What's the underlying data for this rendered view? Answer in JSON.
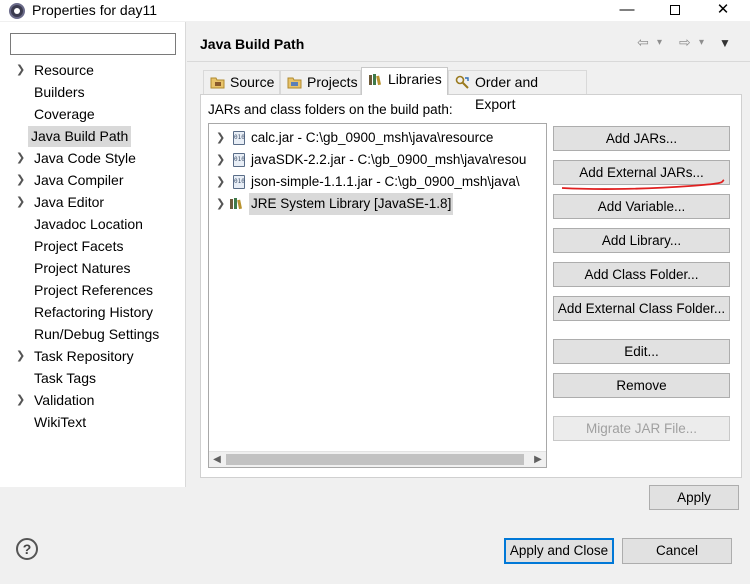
{
  "window": {
    "title": "Properties for day11",
    "icon": "eclipse-icon"
  },
  "filter": {
    "value": "",
    "placeholder": ""
  },
  "tree": [
    {
      "label": "Resource",
      "expandable": true,
      "selected": false
    },
    {
      "label": "Builders",
      "expandable": false,
      "selected": false
    },
    {
      "label": "Coverage",
      "expandable": false,
      "selected": false
    },
    {
      "label": "Java Build Path",
      "expandable": false,
      "selected": true
    },
    {
      "label": "Java Code Style",
      "expandable": true,
      "selected": false
    },
    {
      "label": "Java Compiler",
      "expandable": true,
      "selected": false
    },
    {
      "label": "Java Editor",
      "expandable": true,
      "selected": false
    },
    {
      "label": "Javadoc Location",
      "expandable": false,
      "selected": false
    },
    {
      "label": "Project Facets",
      "expandable": false,
      "selected": false
    },
    {
      "label": "Project Natures",
      "expandable": false,
      "selected": false
    },
    {
      "label": "Project References",
      "expandable": false,
      "selected": false
    },
    {
      "label": "Refactoring History",
      "expandable": false,
      "selected": false
    },
    {
      "label": "Run/Debug Settings",
      "expandable": false,
      "selected": false
    },
    {
      "label": "Task Repository",
      "expandable": true,
      "selected": false
    },
    {
      "label": "Task Tags",
      "expandable": false,
      "selected": false
    },
    {
      "label": "Validation",
      "expandable": true,
      "selected": false
    },
    {
      "label": "WikiText",
      "expandable": false,
      "selected": false
    }
  ],
  "page": {
    "title": "Java Build Path"
  },
  "tabs": [
    {
      "label": "Source",
      "active": false
    },
    {
      "label": "Projects",
      "active": false
    },
    {
      "label": "Libraries",
      "active": true
    },
    {
      "label": "Order and Export",
      "active": false
    }
  ],
  "libraries": {
    "header": "JARs and class folders on the build path:",
    "items": [
      {
        "label": "calc.jar - C:\\gb_0900_msh\\java\\resource",
        "type": "jar"
      },
      {
        "label": "javaSDK-2.2.jar - C:\\gb_0900_msh\\java\\resou",
        "type": "jar"
      },
      {
        "label": "json-simple-1.1.1.jar - C:\\gb_0900_msh\\java\\",
        "type": "jar"
      },
      {
        "label": "JRE System Library [JavaSE-1.8]",
        "type": "jre",
        "selected": true
      }
    ]
  },
  "side_buttons": {
    "add_jars": "Add JARs...",
    "add_external_jars": "Add External JARs...",
    "add_variable": "Add Variable...",
    "add_library": "Add Library...",
    "add_class_folder": "Add Class Folder...",
    "add_external_class_folder": "Add External Class Folder...",
    "edit": "Edit...",
    "remove": "Remove",
    "migrate_jar": "Migrate JAR File..."
  },
  "footer": {
    "apply": "Apply",
    "apply_and_close": "Apply and Close",
    "cancel": "Cancel",
    "help": "?"
  },
  "colors": {
    "accent": "#0078d7",
    "annotation": "#e02020",
    "selection": "#d9d9d9"
  }
}
